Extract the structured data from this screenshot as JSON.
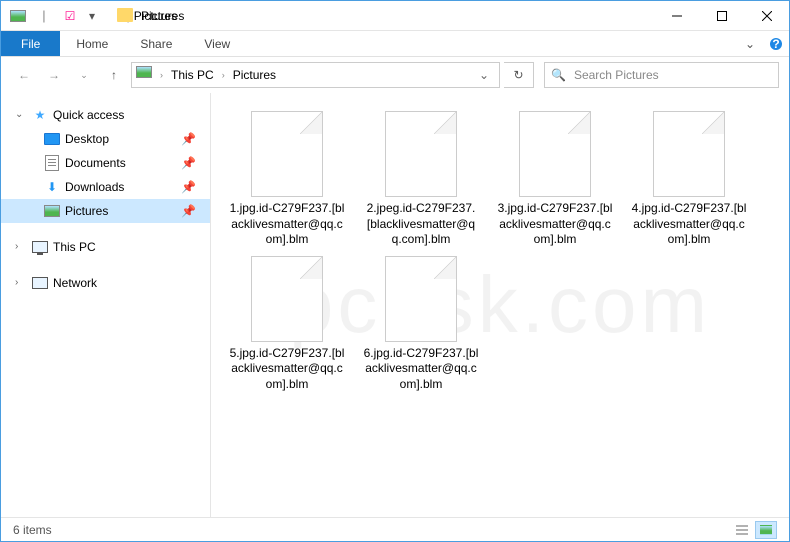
{
  "window": {
    "title": "Pictures"
  },
  "qat": {
    "check": "✓",
    "dropdown": "▾"
  },
  "ribbon": {
    "file": "File",
    "tabs": [
      "Home",
      "Share",
      "View"
    ]
  },
  "nav": {
    "crumb_root": "This PC",
    "crumb_current": "Pictures",
    "search_placeholder": "Search Pictures"
  },
  "sidebar": {
    "quick_access": "Quick access",
    "items": [
      {
        "label": "Desktop"
      },
      {
        "label": "Documents"
      },
      {
        "label": "Downloads"
      },
      {
        "label": "Pictures"
      }
    ],
    "this_pc": "This PC",
    "network": "Network"
  },
  "files": [
    {
      "name": "1.jpg.id-C279F237.[blacklivesmatter@qq.com].blm"
    },
    {
      "name": "2.jpeg.id-C279F237.[blacklivesmatter@qq.com].blm"
    },
    {
      "name": "3.jpg.id-C279F237.[blacklivesmatter@qq.com].blm"
    },
    {
      "name": "4.jpg.id-C279F237.[blacklivesmatter@qq.com].blm"
    },
    {
      "name": "5.jpg.id-C279F237.[blacklivesmatter@qq.com].blm"
    },
    {
      "name": "6.jpg.id-C279F237.[blacklivesmatter@qq.com].blm"
    }
  ],
  "status": {
    "count_text": "6 items"
  },
  "watermark": "pcrisk.com"
}
